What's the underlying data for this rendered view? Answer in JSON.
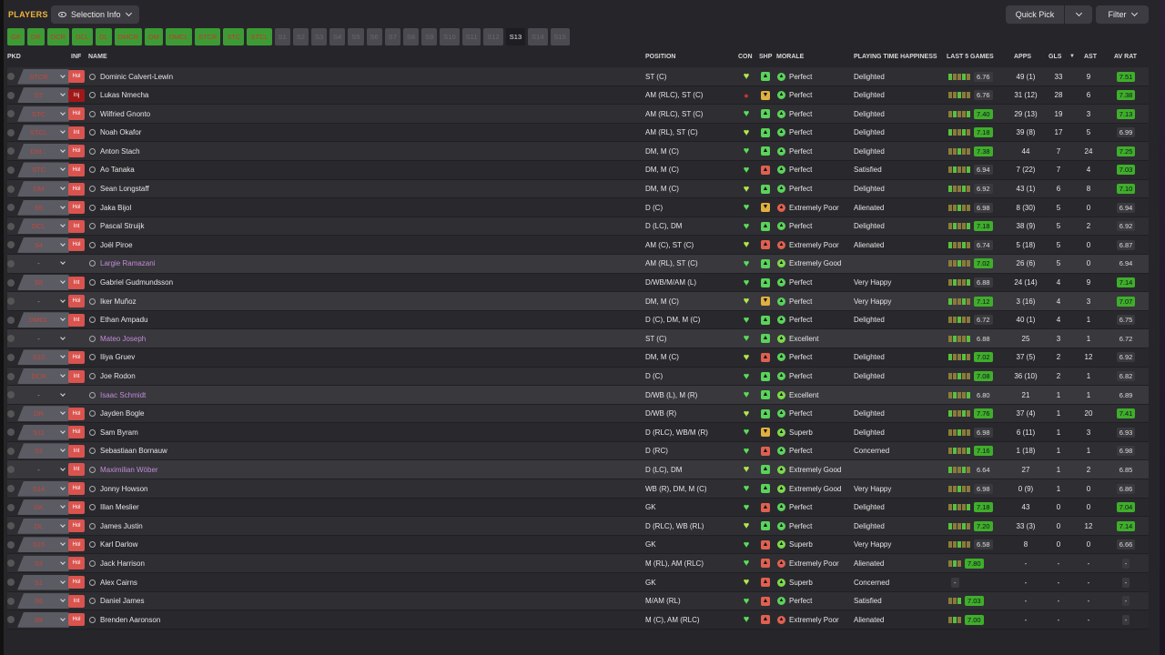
{
  "header": {
    "title": "PLAYERS",
    "selection_info": "Selection Info",
    "quick_pick": "Quick Pick",
    "filter": "Filter"
  },
  "chips": [
    {
      "label": "GK",
      "state": "on"
    },
    {
      "label": "DR",
      "state": "on"
    },
    {
      "label": "DCR",
      "state": "on"
    },
    {
      "label": "DCL",
      "state": "on"
    },
    {
      "label": "DL",
      "state": "on"
    },
    {
      "label": "DMCR",
      "state": "on"
    },
    {
      "label": "DM",
      "state": "on"
    },
    {
      "label": "DMCL",
      "state": "on"
    },
    {
      "label": "STCR",
      "state": "on"
    },
    {
      "label": "STC",
      "state": "on"
    },
    {
      "label": "STCL",
      "state": "on"
    },
    {
      "label": "S1",
      "state": "dim"
    },
    {
      "label": "S2",
      "state": "dim"
    },
    {
      "label": "S3",
      "state": "dim"
    },
    {
      "label": "S4",
      "state": "dim"
    },
    {
      "label": "S5",
      "state": "dim"
    },
    {
      "label": "S6",
      "state": "dim"
    },
    {
      "label": "S7",
      "state": "dim"
    },
    {
      "label": "S8",
      "state": "dim"
    },
    {
      "label": "S9",
      "state": "dim"
    },
    {
      "label": "S10",
      "state": "dim"
    },
    {
      "label": "S11",
      "state": "dim"
    },
    {
      "label": "S12",
      "state": "dim"
    },
    {
      "label": "S13",
      "state": "sel"
    },
    {
      "label": "S14",
      "state": "dim"
    },
    {
      "label": "S15",
      "state": "dim"
    }
  ],
  "columns": {
    "pkd": "PKD",
    "inf": "INF",
    "name": "NAME",
    "position": "POSITION",
    "con": "CON",
    "shp": "SHP",
    "morale": "MORALE",
    "happiness": "PLAYING TIME HAPPINESS",
    "last5": "LAST 5 GAMES",
    "apps": "APPS",
    "gls": "GLS",
    "ast": "AST",
    "avrat": "AV RAT"
  },
  "rows": [
    {
      "pkd": "STCR",
      "inf": "Hol",
      "name": "Dominic Calvert-Lewin",
      "pos": "ST (C)",
      "morale": "Perfect",
      "happy": "Delighted",
      "l5": "6.76",
      "apps": "49 (1)",
      "gls": "33",
      "ast": "9",
      "av": "7.51"
    },
    {
      "pkd": "ST",
      "inf": "Inj",
      "name": "Lukas Nmecha",
      "pos": "AM (RLC), ST (C)",
      "morale": "Perfect",
      "happy": "Delighted",
      "l5": "6.76",
      "apps": "31 (12)",
      "gls": "28",
      "ast": "6",
      "av": "7.38"
    },
    {
      "pkd": "STC",
      "inf": "Hol",
      "name": "Wilfried Gnonto",
      "pos": "AM (RLC), ST (C)",
      "morale": "Perfect",
      "happy": "Delighted",
      "l5": "7.40",
      "apps": "29 (13)",
      "gls": "19",
      "ast": "3",
      "av": "7.13"
    },
    {
      "pkd": "STCL",
      "inf": "Int",
      "name": "Noah Okafor",
      "pos": "AM (RL), ST (C)",
      "morale": "Perfect",
      "happy": "Delighted",
      "l5": "7.18",
      "apps": "39 (8)",
      "gls": "17",
      "ast": "5",
      "av": "6.99"
    },
    {
      "pkd": "DM...",
      "inf": "Hol",
      "name": "Anton Stach",
      "pos": "DM, M (C)",
      "morale": "Perfect",
      "happy": "Delighted",
      "l5": "7.38",
      "apps": "44",
      "gls": "7",
      "ast": "24",
      "av": "7.25"
    },
    {
      "pkd": "STC",
      "inf": "Hol",
      "name": "Ao Tanaka",
      "pos": "DM, M (C)",
      "morale": "Perfect",
      "happy": "Satisfied",
      "l5": "6.94",
      "apps": "7 (22)",
      "gls": "7",
      "ast": "4",
      "av": "7.03"
    },
    {
      "pkd": "DM",
      "inf": "Hol",
      "name": "Sean Longstaff",
      "pos": "DM, M (C)",
      "morale": "Perfect",
      "happy": "Delighted",
      "l5": "6.92",
      "apps": "43 (1)",
      "gls": "6",
      "ast": "8",
      "av": "7.10"
    },
    {
      "pkd": "S5",
      "inf": "Hol",
      "name": "Jaka Bijol",
      "pos": "D (C)",
      "morale": "Extremely Poor",
      "happy": "Alienated",
      "l5": "6.98",
      "apps": "8 (30)",
      "gls": "5",
      "ast": "0",
      "av": "6.94"
    },
    {
      "pkd": "DCL",
      "inf": "Int",
      "name": "Pascal Struijk",
      "pos": "D (LC), DM",
      "morale": "Perfect",
      "happy": "Delighted",
      "l5": "7.18",
      "apps": "38 (9)",
      "gls": "5",
      "ast": "2",
      "av": "6.92"
    },
    {
      "pkd": "S4",
      "inf": "Hol",
      "name": "Joël Piroe",
      "pos": "AM (C), ST (C)",
      "morale": "Extremely Poor",
      "happy": "Alienated",
      "l5": "6.74",
      "apps": "5 (18)",
      "gls": "5",
      "ast": "0",
      "av": "6.87"
    },
    {
      "pkd": "-",
      "inf": "",
      "name": "Largie Ramazani",
      "pos": "AM (RL), ST (C)",
      "morale": "Extremely Good",
      "happy": "",
      "l5": "7.02",
      "apps": "26 (6)",
      "gls": "5",
      "ast": "0",
      "av": "6.94",
      "loan": true
    },
    {
      "pkd": "S8",
      "inf": "Int",
      "name": "Gabriel Gudmundsson",
      "pos": "D/WB/M/AM (L)",
      "morale": "Perfect",
      "happy": "Very Happy",
      "l5": "6.88",
      "apps": "24 (14)",
      "gls": "4",
      "ast": "9",
      "av": "7.14"
    },
    {
      "pkd": "-",
      "inf": "Hol",
      "name": "Iker Muñoz",
      "pos": "DM, M (C)",
      "morale": "Perfect",
      "happy": "Very Happy",
      "l5": "7.12",
      "apps": "3 (16)",
      "gls": "4",
      "ast": "3",
      "av": "7.07",
      "loan": false,
      "unsel": true
    },
    {
      "pkd": "DMCL",
      "inf": "Int",
      "name": "Ethan Ampadu",
      "pos": "D (C), DM, M (C)",
      "morale": "Perfect",
      "happy": "Delighted",
      "l5": "6.72",
      "apps": "40 (1)",
      "gls": "4",
      "ast": "1",
      "av": "6.75"
    },
    {
      "pkd": "-",
      "inf": "",
      "name": "Mateo Joseph",
      "pos": "ST (C)",
      "morale": "Excellent",
      "happy": "",
      "l5": "6.88",
      "apps": "25",
      "gls": "3",
      "ast": "1",
      "av": "6.72",
      "loan": true
    },
    {
      "pkd": "S10",
      "inf": "Hol",
      "name": "Iliya Gruev",
      "pos": "DM, M (C)",
      "morale": "Perfect",
      "happy": "Delighted",
      "l5": "7.02",
      "apps": "37 (5)",
      "gls": "2",
      "ast": "12",
      "av": "6.92"
    },
    {
      "pkd": "DCR",
      "inf": "Int",
      "name": "Joe Rodon",
      "pos": "D (C)",
      "morale": "Perfect",
      "happy": "Delighted",
      "l5": "7.08",
      "apps": "36 (10)",
      "gls": "2",
      "ast": "1",
      "av": "6.82"
    },
    {
      "pkd": "-",
      "inf": "",
      "name": "Isaac Schmidt",
      "pos": "D/WB (L), M (R)",
      "morale": "Excellent",
      "happy": "",
      "l5": "6.80",
      "apps": "21",
      "gls": "1",
      "ast": "1",
      "av": "6.89",
      "loan": true
    },
    {
      "pkd": "DR",
      "inf": "Hol",
      "name": "Jayden Bogle",
      "pos": "D/WB (R)",
      "morale": "Perfect",
      "happy": "Delighted",
      "l5": "7.76",
      "apps": "37 (4)",
      "gls": "1",
      "ast": "20",
      "av": "7.41"
    },
    {
      "pkd": "S11",
      "inf": "Hol",
      "name": "Sam Byram",
      "pos": "D (RLC), WB/M (R)",
      "morale": "Superb",
      "happy": "Delighted",
      "l5": "6.98",
      "apps": "6 (11)",
      "gls": "1",
      "ast": "3",
      "av": "6.93"
    },
    {
      "pkd": "S2",
      "inf": "Int",
      "name": "Sebastiaan Bornauw",
      "pos": "D (RC)",
      "morale": "Perfect",
      "happy": "Concerned",
      "l5": "7.16",
      "apps": "1 (18)",
      "gls": "1",
      "ast": "1",
      "av": "6.98"
    },
    {
      "pkd": "-",
      "inf": "Int",
      "name": "Maximilian Wöber",
      "pos": "D (LC), DM",
      "morale": "Extremely Good",
      "happy": "",
      "l5": "6.64",
      "apps": "27",
      "gls": "1",
      "ast": "2",
      "av": "6.85",
      "loan": true
    },
    {
      "pkd": "S14",
      "inf": "Hol",
      "name": "Jonny Howson",
      "pos": "WB (R), DM, M (C)",
      "morale": "Extremely Good",
      "happy": "Very Happy",
      "l5": "6.98",
      "apps": "0 (9)",
      "gls": "1",
      "ast": "0",
      "av": "6.86"
    },
    {
      "pkd": "GK",
      "inf": "Hol",
      "name": "Illan Meslier",
      "pos": "GK",
      "morale": "Perfect",
      "happy": "Delighted",
      "l5": "7.18",
      "apps": "43",
      "gls": "0",
      "ast": "0",
      "av": "7.04"
    },
    {
      "pkd": "DL",
      "inf": "Hol",
      "name": "James Justin",
      "pos": "D (RLC), WB (RL)",
      "morale": "Perfect",
      "happy": "Delighted",
      "l5": "7.20",
      "apps": "33 (3)",
      "gls": "0",
      "ast": "12",
      "av": "7.14"
    },
    {
      "pkd": "S15",
      "inf": "Hol",
      "name": "Karl Darlow",
      "pos": "GK",
      "morale": "Superb",
      "happy": "Very Happy",
      "l5": "6.58",
      "apps": "8",
      "gls": "0",
      "ast": "0",
      "av": "6.66"
    },
    {
      "pkd": "S3",
      "inf": "Hol",
      "name": "Jack Harrison",
      "pos": "M (RL), AM (RLC)",
      "morale": "Extremely Poor",
      "happy": "Alienated",
      "l5": "7.80",
      "apps": "-",
      "gls": "-",
      "ast": "-",
      "av": "-"
    },
    {
      "pkd": "S1",
      "inf": "Hol",
      "name": "Alex Cairns",
      "pos": "GK",
      "morale": "Superb",
      "happy": "Concerned",
      "l5": "-",
      "apps": "-",
      "gls": "-",
      "ast": "-",
      "av": "-"
    },
    {
      "pkd": "S6",
      "inf": "Int",
      "name": "Daniel James",
      "pos": "M/AM (RL)",
      "morale": "Perfect",
      "happy": "Satisfied",
      "l5": "7.03",
      "apps": "-",
      "gls": "-",
      "ast": "-",
      "av": "-"
    },
    {
      "pkd": "S9",
      "inf": "Hol",
      "name": "Brenden Aaronson",
      "pos": "M (C), AM (RLC)",
      "morale": "Extremely Poor",
      "happy": "Alienated",
      "l5": "7.00",
      "apps": "-",
      "gls": "-",
      "ast": "-",
      "av": "-"
    }
  ]
}
